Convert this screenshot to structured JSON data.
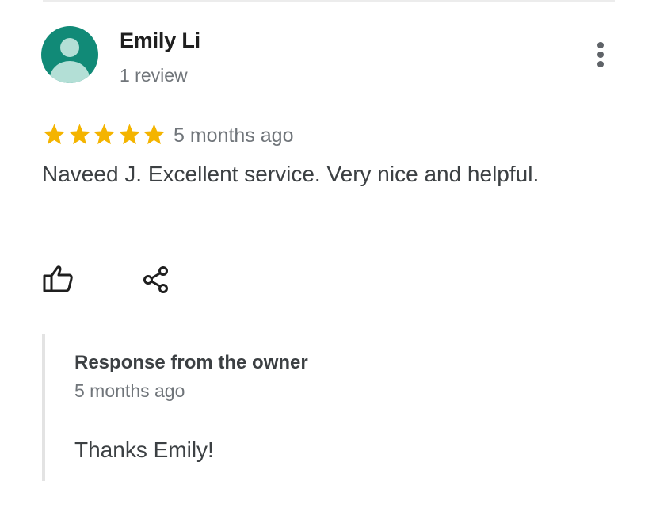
{
  "reviewer": {
    "name": "Emily Li",
    "review_count": "1 review",
    "avatar_color": "#118a77"
  },
  "review": {
    "rating": 5,
    "max_rating": 5,
    "star_color": "#f4b400",
    "date": "5 months ago",
    "text": "Naveed J. Excellent service. Very nice and helpful."
  },
  "actions": {
    "like_icon": "thumbs-up-outline",
    "share_icon": "share",
    "more_icon": "more-vertical"
  },
  "owner_response": {
    "title": "Response from the owner",
    "date": "5 months ago",
    "text": "Thanks Emily!"
  }
}
